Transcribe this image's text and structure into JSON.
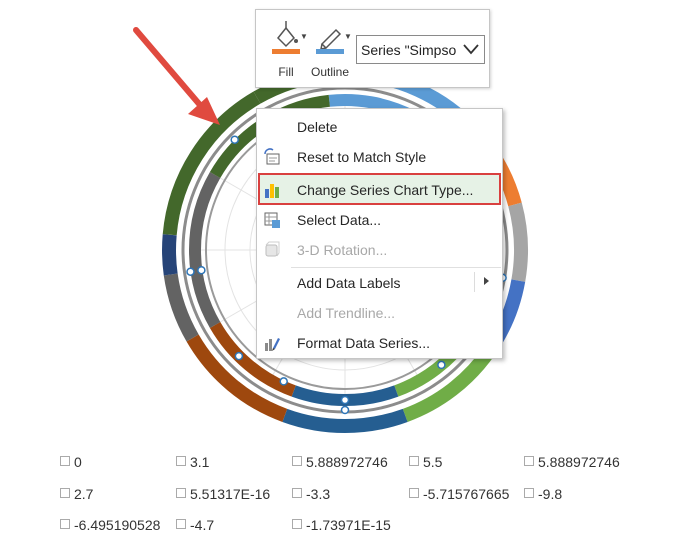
{
  "mini_toolbar": {
    "fill_label": "Fill",
    "outline_label": "Outline",
    "series_selector_value": "Series \"Simpso",
    "fill_color": "#ed7d31",
    "outline_color": "#5b9bd5"
  },
  "context_menu": {
    "items": [
      {
        "label": "Delete",
        "icon": "none",
        "enabled": true
      },
      {
        "label": "Reset to Match Style",
        "icon": "reset-style-icon",
        "enabled": true
      },
      {
        "label": "Change Series Chart Type...",
        "icon": "change-chart-type-icon",
        "enabled": true,
        "highlighted": true
      },
      {
        "label": "Select Data...",
        "icon": "select-data-icon",
        "enabled": true
      },
      {
        "label": "3-D Rotation...",
        "icon": "3d-rotation-icon",
        "enabled": false
      },
      {
        "label": "Add Data Labels",
        "icon": "none",
        "enabled": true,
        "submenu": true
      },
      {
        "label": "Add Trendline...",
        "icon": "none",
        "enabled": false
      },
      {
        "label": "Format Data Series...",
        "icon": "format-series-icon",
        "enabled": true
      }
    ]
  },
  "legend": {
    "items": [
      "0",
      "3.1",
      "5.888972746",
      "5.5",
      "5.888972746",
      "2.7",
      "5.51317E-16",
      "-3.3",
      "-5.715767665",
      "-9.8",
      "-6.495190528",
      "-4.7",
      "-1.73971E-15"
    ]
  },
  "chart_colors": {
    "annotation_arrow": "#e04a3f",
    "highlight_border": "#d9403f",
    "series_palette": [
      "#5b9bd5",
      "#ed7d31",
      "#a5a5a5",
      "#4472c4",
      "#70ad47",
      "#255e91",
      "#9e480e",
      "#636363",
      "#264478",
      "#43682b"
    ]
  }
}
